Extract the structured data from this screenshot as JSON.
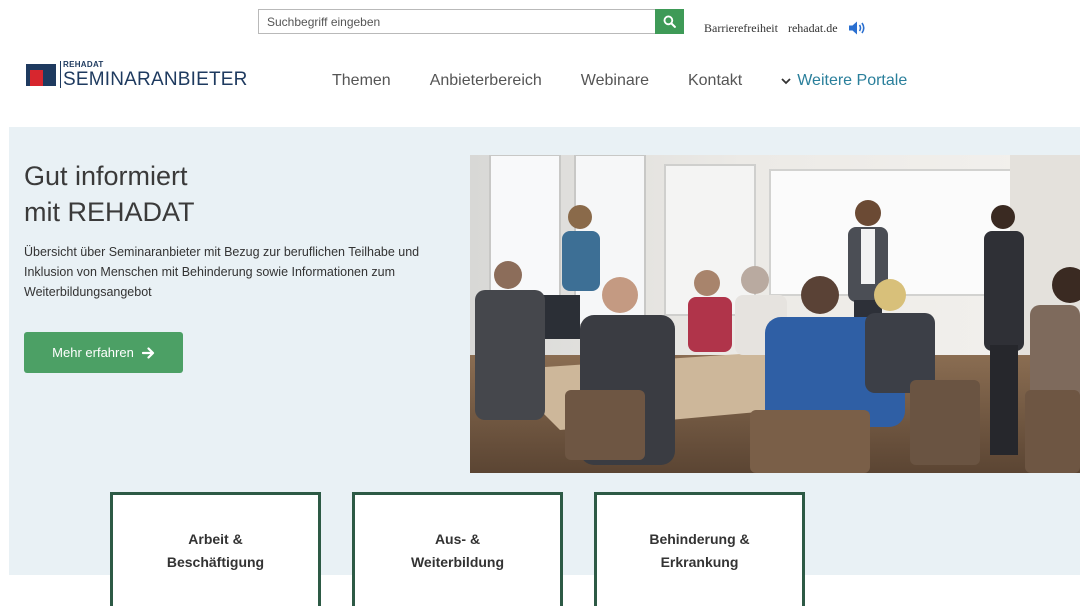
{
  "header": {
    "search": {
      "placeholder": "Suchbegriff eingeben",
      "value": ""
    },
    "util_links": [
      "Barrierefreiheit",
      "rehadat.de"
    ]
  },
  "logo": {
    "small": "REHADAT",
    "big": "SEMINARANBIETER"
  },
  "nav": {
    "items": [
      "Themen",
      "Anbieterbereich",
      "Webinare",
      "Kontakt"
    ],
    "more": "Weitere Portale"
  },
  "hero": {
    "title_line1": "Gut informiert",
    "title_line2": "mit REHADAT",
    "desc": "Übersicht über Seminaranbieter mit Bezug zur beruflichen Teilhabe und Inklusion von Menschen mit Behinderung sowie Informationen zum Weiterbildungsangebot",
    "cta": "Mehr erfahren"
  },
  "cards": [
    {
      "line1": "Arbeit & Beschäftigung",
      "line2": ""
    },
    {
      "line1": "Aus- & Weiterbildung",
      "line2": ""
    },
    {
      "line1": "Behinderung &",
      "line2": "Erkrankung"
    }
  ],
  "icons": {
    "search": "search-icon",
    "speaker": "speaker-icon",
    "chevron": "chevron-down-icon",
    "arrow": "arrow-right-icon"
  },
  "colors": {
    "accent_green": "#3e9a57",
    "cta_green": "#4ca065",
    "card_border": "#2d5a45",
    "brand_navy": "#1e3a5f",
    "logo_red": "#d7262e",
    "link_teal": "#2a7f9b",
    "hero_bg": "#e9f1f5"
  }
}
